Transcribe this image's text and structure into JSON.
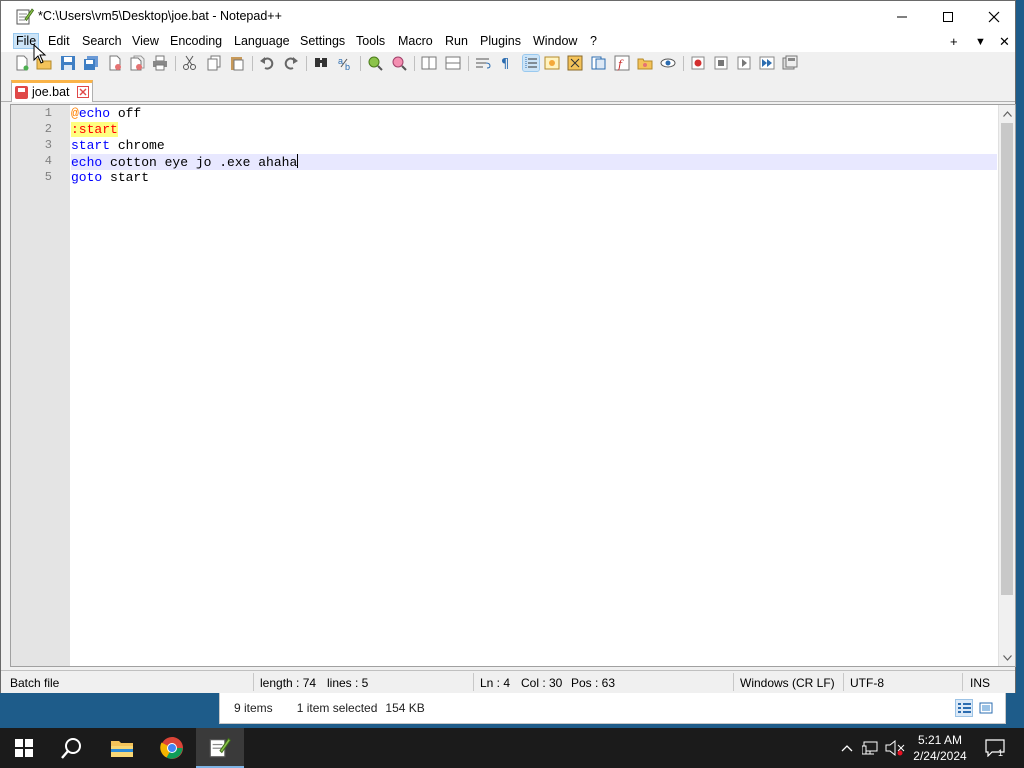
{
  "window": {
    "title": "*C:\\Users\\vm5\\Desktop\\joe.bat - Notepad++"
  },
  "menu": {
    "items": [
      "File",
      "Edit",
      "Search",
      "View",
      "Encoding",
      "Language",
      "Settings",
      "Tools",
      "Macro",
      "Run",
      "Plugins",
      "Window",
      "?"
    ],
    "right_controls": [
      "+",
      "▼",
      "✕"
    ]
  },
  "tab": {
    "label": "joe.bat"
  },
  "editor": {
    "line_numbers": [
      "1",
      "2",
      "3",
      "4",
      "5"
    ],
    "lines": [
      [
        {
          "t": "@",
          "c": "at"
        },
        {
          "t": "echo",
          "c": "kw"
        },
        {
          "t": " off",
          "c": "txt"
        }
      ],
      [
        {
          "t": ":start",
          "c": "lbl"
        }
      ],
      [
        {
          "t": "start",
          "c": "kw"
        },
        {
          "t": " chrome",
          "c": "txt"
        }
      ],
      [
        {
          "t": "echo",
          "c": "kw"
        },
        {
          "t": " cotton eye jo .exe ahaha",
          "c": "txt"
        }
      ],
      [
        {
          "t": "goto",
          "c": "kw"
        },
        {
          "t": " start",
          "c": "txt"
        }
      ]
    ],
    "current_line": 4
  },
  "status": {
    "file_type": "Batch file",
    "length": "length : 74",
    "lines": "lines : 5",
    "ln": "Ln : 4",
    "col": "Col : 30",
    "pos": "Pos : 63",
    "eol": "Windows (CR LF)",
    "encoding": "UTF-8",
    "mode": "INS"
  },
  "explorer_status": {
    "items": "9 items",
    "selected": "1 item selected",
    "size": "154 KB"
  },
  "taskbar": {
    "apps": [
      "start-icon",
      "search-icon",
      "file-explorer-icon",
      "chrome-icon",
      "notepad-plus-plus-icon"
    ],
    "time": "5:21 AM",
    "date": "2/24/2024",
    "notification_count": "1"
  },
  "colors": {
    "keyword": "#0000ff",
    "at_sign": "#ff8000",
    "label_fg": "#ff0000",
    "label_bg": "#ffff80",
    "current_line_bg": "#e8e8ff",
    "tab_accent": "#fab347"
  }
}
